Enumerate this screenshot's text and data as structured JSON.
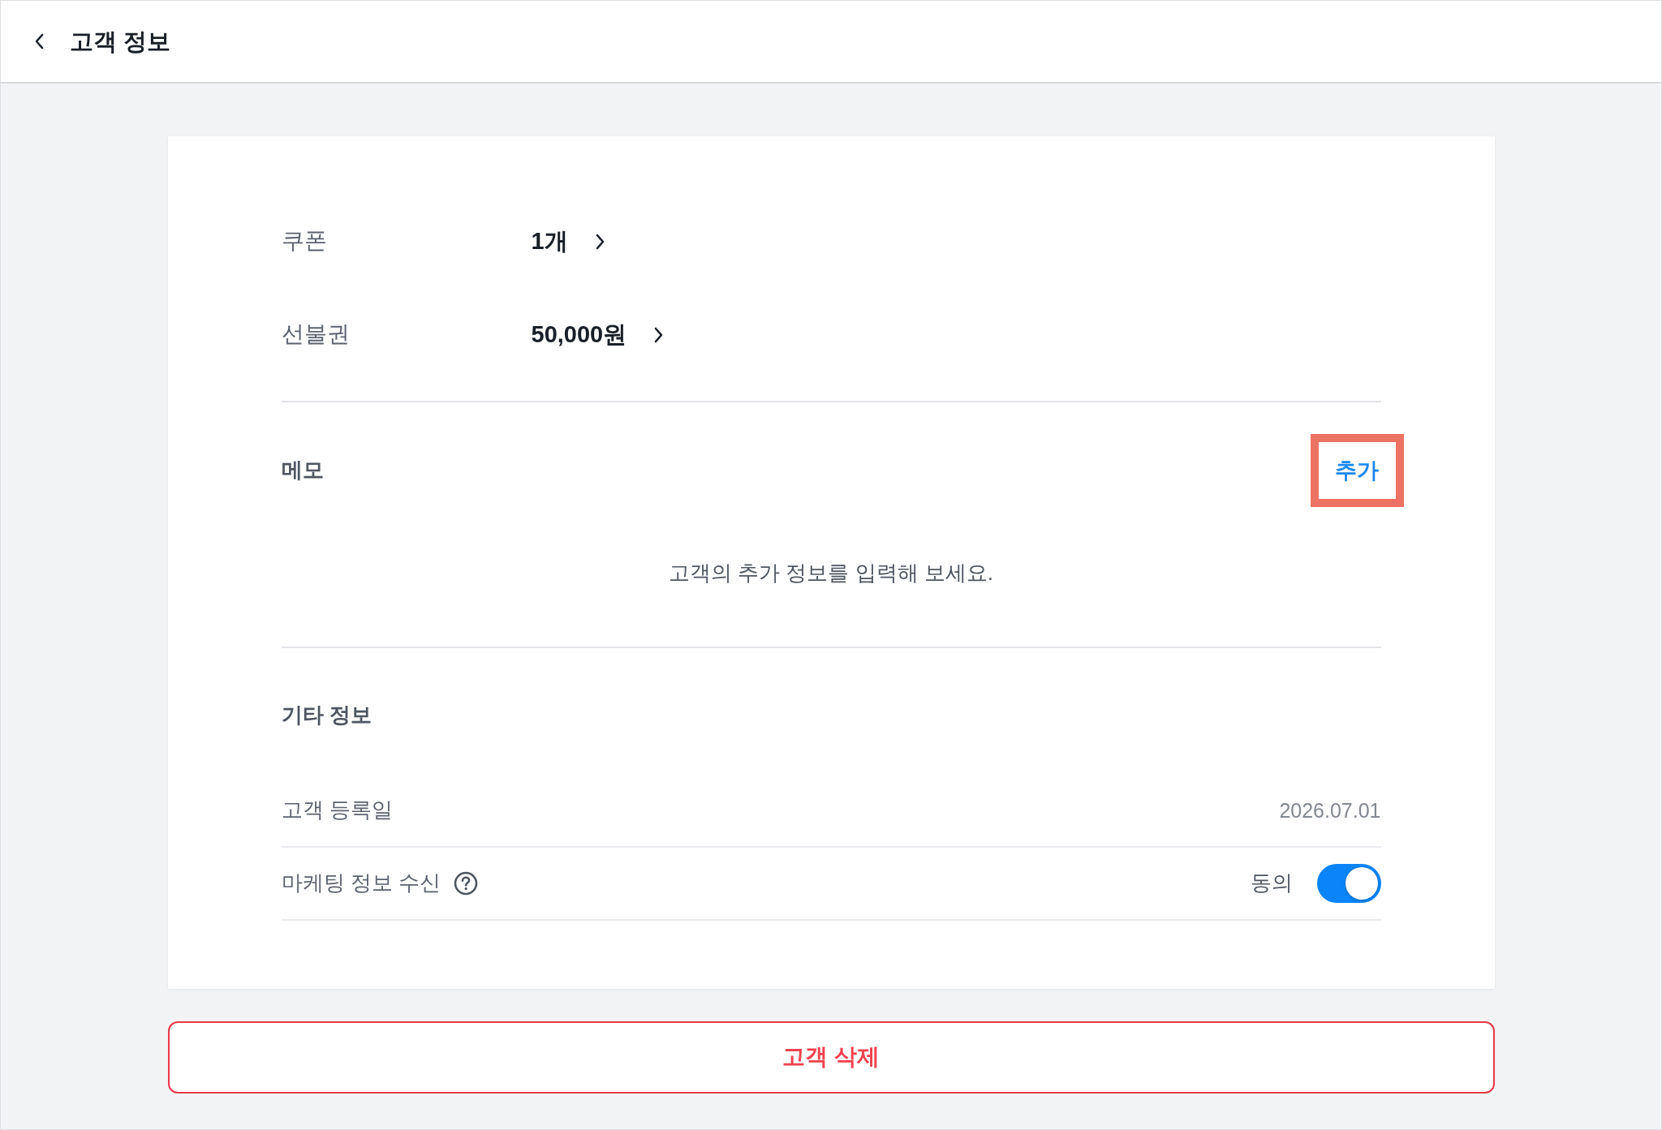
{
  "header": {
    "title": "고객 정보"
  },
  "summary": [
    {
      "label": "쿠폰",
      "value": "1개"
    },
    {
      "label": "선불권",
      "value": "50,000원"
    }
  ],
  "memo": {
    "title": "메모",
    "add_button": {
      "label": "추가",
      "highlighted": true
    },
    "empty_text": "고객의 추가 정보를 입력해 보세요."
  },
  "other_info": {
    "title": "기타 정보",
    "rows": [
      {
        "kind": "text",
        "label": "고객 등록일",
        "value": "2026.07.01"
      },
      {
        "kind": "toggle",
        "label": "마케팅 정보 수신",
        "help": true,
        "value": "동의",
        "on": true
      }
    ]
  },
  "delete_button": {
    "label": "고객 삭제"
  }
}
